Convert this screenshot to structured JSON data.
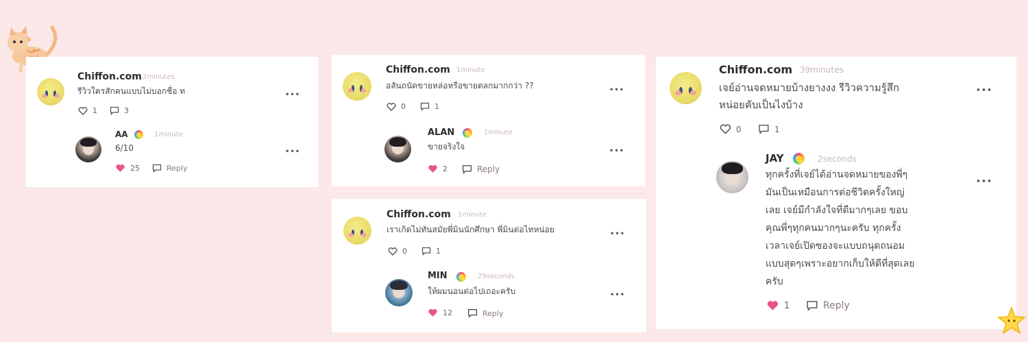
{
  "card1": {
    "comment": {
      "user": "Chiffon.com",
      "time": "2minutes",
      "text": "รีวิวใครสักคนแบบไม่บอกชื่อ ท",
      "likes": "1",
      "comments": "3"
    },
    "reply": {
      "user": "AA",
      "time": "1minute",
      "text": "6/10",
      "likes": "25",
      "reply_label": "Reply"
    }
  },
  "card2": {
    "comment": {
      "user": "Chiffon.com",
      "time": "1minute",
      "text": "อลันถนัดขายหล่อหรือขายตลกมากกว่า ??",
      "likes": "0",
      "comments": "1"
    },
    "reply": {
      "user": "ALAN",
      "time": "1minute",
      "text": "ขายจริงใจ",
      "likes": "2",
      "reply_label": "Reply"
    }
  },
  "card3": {
    "comment": {
      "user": "Chiffon.com",
      "time": "1minute",
      "text": "เราเกิดไม่ทันสมัยพี่มินนักศึกษา พี่มินต่อไทหน่อย",
      "likes": "0",
      "comments": "1"
    },
    "reply": {
      "user": "MIN",
      "time": "29seconds",
      "text": "ให้ผมนอนต่อไปเถอะครับ",
      "likes": "12",
      "reply_label": "Reply"
    }
  },
  "card4": {
    "comment": {
      "user": "Chiffon.com",
      "time": "39minutes",
      "text_line1": "เจย์อ่านจดหมายบ้างยางงง รีวิวความรู้สึก",
      "text_line2": "หน่อยคับเป็นไงบ้าง",
      "likes": "0",
      "comments": "1"
    },
    "reply": {
      "user": "JAY",
      "time": "2seconds",
      "lines": [
        "ทุกครั้งที่เจย์ได้อ่านจดหมายของพี่ๆ",
        "มันเป็นเหมือนการต่อชีวิตครั้งใหญ่",
        "เลย เจย์มีกำลังใจที่ดีมากๆเลย ขอบ",
        "คุณพี่ๆทุกคนมากๆนะครับ ทุกครั้ง",
        "เวลาเจย์เปิดซองจะแบบถนุดถนอม",
        "แบบสุดๆเพราะอยากเก็บให้ดีที่สุดเลย",
        "ครับ"
      ],
      "likes": "1",
      "reply_label": "Reply"
    }
  },
  "more_label": "•••",
  "colors": {
    "background": "#fce8e8",
    "heart": "#e8567f",
    "time": "#c9b8b8"
  }
}
